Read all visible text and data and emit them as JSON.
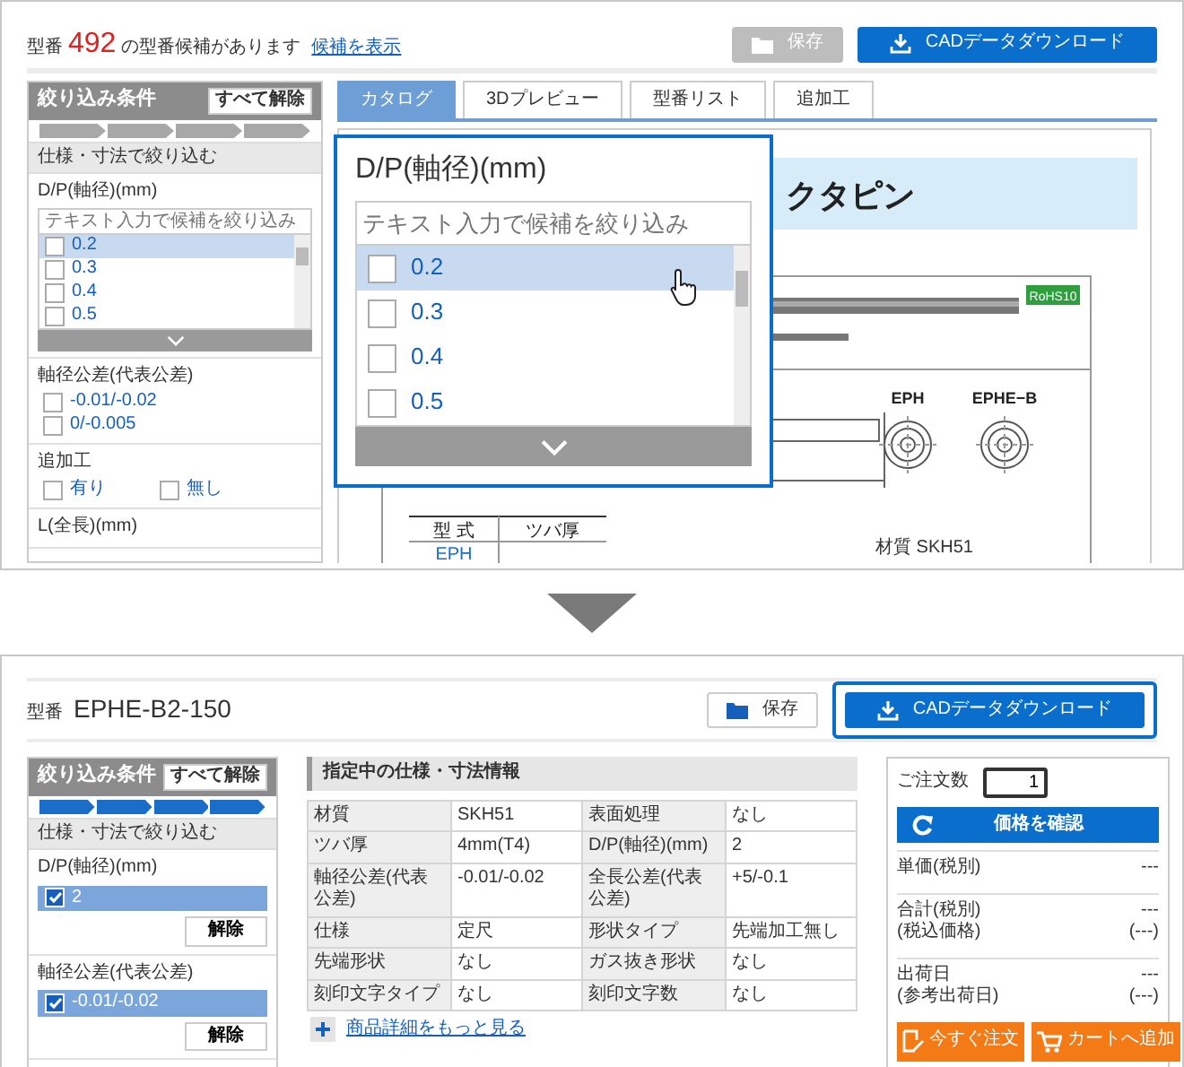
{
  "top_screen": {
    "header": {
      "label": "型番",
      "count": "492",
      "message": "の型番候補があります",
      "link": "候補を表示"
    },
    "buttons": [
      {
        "kind": "save",
        "label": "保存",
        "disabled": true,
        "highlighted": false
      },
      {
        "kind": "download",
        "label": "CADデータダウンロード",
        "disabled": false,
        "highlighted": false
      }
    ],
    "sidebar": {
      "title": "絞り込み条件",
      "clear_all": "すべて解除",
      "steps": [
        {
          "done": false
        },
        {
          "done": false
        },
        {
          "done": false
        },
        {
          "done": false
        }
      ],
      "section": "仕様・寸法で絞り込む",
      "filters": [
        {
          "kind": "list",
          "label": "D/P(軸径)(mm)",
          "placeholder": "テキスト入力で候補を絞り込み",
          "options": [
            {
              "label": "0.2",
              "checked": false,
              "selected": true
            },
            {
              "label": "0.3",
              "checked": false,
              "selected": false
            },
            {
              "label": "0.4",
              "checked": false,
              "selected": false
            },
            {
              "label": "0.5",
              "checked": false,
              "selected": false
            }
          ]
        },
        {
          "kind": "checks",
          "label": "軸径公差(代表公差)",
          "options": [
            {
              "label": "-0.01/-0.02",
              "checked": false
            },
            {
              "label": "0/-0.005",
              "checked": false
            }
          ]
        },
        {
          "kind": "inline",
          "label": "追加工",
          "options": [
            {
              "label": "有り",
              "checked": false
            },
            {
              "label": "無し",
              "checked": false
            }
          ]
        },
        {
          "kind": "heading",
          "label": "L(全長)(mm)"
        }
      ]
    },
    "tabs": [
      {
        "label": "カタログ",
        "selected": true
      },
      {
        "label": "3Dプレビュー",
        "selected": false
      },
      {
        "label": "型番リスト",
        "selected": false
      },
      {
        "label": "追加工",
        "selected": false
      }
    ],
    "catalog": {
      "title": "クタピン",
      "badge": "RoHS10",
      "views": [
        "EPH",
        "EPHE−B"
      ],
      "table_headers": [
        "型 式",
        "ツバ厚"
      ],
      "table_rows": [
        "EPH"
      ],
      "material": "材質 SKH51"
    },
    "popup": {
      "title": "D/P(軸径)(mm)",
      "placeholder": "テキスト入力で候補を絞り込み",
      "options": [
        {
          "label": "0.2",
          "checked": false,
          "selected": true
        },
        {
          "label": "0.3",
          "checked": false,
          "selected": false
        },
        {
          "label": "0.4",
          "checked": false,
          "selected": false
        },
        {
          "label": "0.5",
          "checked": false,
          "selected": false
        }
      ]
    }
  },
  "bottom_screen": {
    "header": {
      "label": "型番",
      "part_number": "EPHE-B2-150"
    },
    "buttons": [
      {
        "kind": "save",
        "label": "保存",
        "disabled": false,
        "highlighted": false
      },
      {
        "kind": "download",
        "label": "CADデータダウンロード",
        "disabled": false,
        "highlighted": true
      }
    ],
    "sidebar": {
      "title": "絞り込み条件",
      "clear_all": "すべて解除",
      "steps": [
        {
          "done": true
        },
        {
          "done": true
        },
        {
          "done": true
        },
        {
          "done": true
        }
      ],
      "section": "仕様・寸法で絞り込む",
      "filters": [
        {
          "kind": "chosen",
          "label": "D/P(軸径)(mm)",
          "options": [
            {
              "label": "2",
              "checked": true
            }
          ],
          "clear": "解除"
        },
        {
          "kind": "chosen",
          "label": "軸径公差(代表公差)",
          "options": [
            {
              "label": "-0.01/-0.02",
              "checked": true
            }
          ],
          "clear": "解除"
        }
      ]
    },
    "specs": {
      "title": "指定中の仕様・寸法情報",
      "rows": [
        [
          "材質",
          "SKH51",
          "表面処理",
          "なし"
        ],
        [
          "ツバ厚",
          "4mm(T4)",
          "D/P(軸径)(mm)",
          "2"
        ],
        [
          "軸径公差(代表公差)",
          "-0.01/-0.02",
          "全長公差(代表公差)",
          "+5/-0.1"
        ],
        [
          "仕様",
          "定尺",
          "形状タイプ",
          "先端加工無し"
        ],
        [
          "先端形状",
          "なし",
          "ガス抜き形状",
          "なし"
        ],
        [
          "刻印文字タイプ",
          "なし",
          "刻印文字数",
          "なし"
        ]
      ],
      "more_link": "商品詳細をもっと見る"
    },
    "order": {
      "quantity_label": "ご注文数",
      "quantity": "1",
      "price_button": "価格を確認",
      "lines": [
        {
          "label": "単価(税別)",
          "value": "---"
        },
        {
          "label": "合計(税別)",
          "sub_label": "(税込価格)",
          "value": "---",
          "sub_value": "(---)"
        },
        {
          "label": "出荷日",
          "sub_label": "(参考出荷日)",
          "value": "---",
          "sub_value": "(---)"
        }
      ],
      "actions": [
        {
          "kind": "order",
          "label": "今すぐ注文"
        },
        {
          "kind": "cart",
          "label": "カートへ追加"
        }
      ]
    }
  }
}
